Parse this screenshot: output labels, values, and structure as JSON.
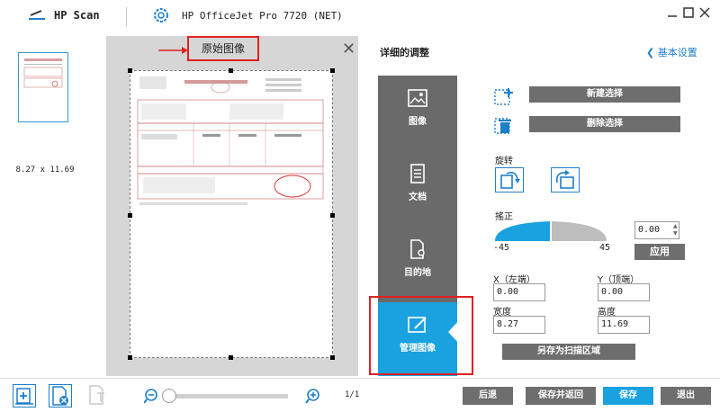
{
  "titlebar": {
    "app_name": "HP Scan",
    "device_name": "HP OfficeJet Pro 7720 (NET)"
  },
  "thumbnail": {
    "size_label": "8.27 x 11.69"
  },
  "preview": {
    "original_image_label": "原始图像"
  },
  "panel": {
    "title": "详细的调整",
    "basic_settings_link": "基本设置",
    "tabs": [
      {
        "label": "图像",
        "icon": "image-icon"
      },
      {
        "label": "文档",
        "icon": "document-icon"
      },
      {
        "label": "目的地",
        "icon": "destination-icon"
      },
      {
        "label": "管理图像",
        "icon": "manage-image-icon",
        "active": true
      }
    ],
    "new_selection_label": "新建选择",
    "delete_selection_label": "删除选择",
    "rotate_label": "旋转",
    "deskew_label": "搖正",
    "deskew_value": "0.00",
    "deskew_min": "-45",
    "deskew_max": "45",
    "apply_label": "应用",
    "x_label": "X（左端）",
    "x_value": "0.00",
    "y_label": "Y（顶端）",
    "y_value": "0.00",
    "width_label": "宽度",
    "width_value": "8.27",
    "height_label": "高度",
    "height_value": "11.69",
    "save_region_label": "另存为扫描区域"
  },
  "bottombar": {
    "page_counter": "1/1",
    "back_label": "后退",
    "save_return_label": "保存并返回",
    "save_label": "保存",
    "exit_label": "退出",
    "zoom_level": 0
  },
  "colors": {
    "accent": "#1aa2e0",
    "tab_bg": "#6a6a6a",
    "highlight_red": "#e02020"
  }
}
